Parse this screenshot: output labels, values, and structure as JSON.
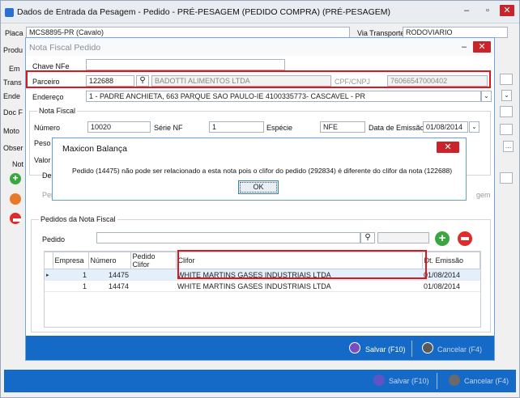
{
  "main_window": {
    "title": "Dados de Entrada da Pesagem - Pedido - PRÉ-PESAGEM (PEDIDO COMPRA) (PRÉ-PESAGEM)",
    "placa_label": "Placa",
    "placa_value": "MCS8895-PR (Cavalo)",
    "via_transporte_label": "Via Transporte",
    "via_transporte_value": "RODOVIARIO",
    "left_labels": [
      "Produ",
      "Em",
      "Trans",
      "Ende",
      "Doc F",
      "Moto",
      "Obser",
      "Not"
    ],
    "salvar_label": "Salvar (F10)",
    "cancelar_label": "Cancelar (F4)"
  },
  "nf_dialog": {
    "title": "Nota Fiscal Pedido",
    "chave_nfe_label": "Chave NFe",
    "chave_nfe_value": "",
    "parceiro_label": "Parceiro",
    "parceiro_code": "122688",
    "parceiro_name": "BADOTTI ALIMENTOS LTDA",
    "cpf_cnpj_label": "CPF/CNPJ",
    "cpf_cnpj_value": "76066547000402",
    "endereco_label": "Endereço",
    "endereco_value": "1 - PADRE ANCHIETA, 663  PARQUE SAO PAULO-IE 4100335773- CASCAVEL - PR",
    "nota_fiscal_group": "Nota Fiscal",
    "numero_label": "Número",
    "numero_value": "10020",
    "serie_label": "Série NF",
    "serie_value": "1",
    "especie_label": "Espécie",
    "especie_value": "NFE",
    "data_emissao_label": "Data de Emissão",
    "data_emissao_value": "01/08/2014",
    "peso_label": "Peso Or",
    "valor_label": "Valor Ur",
    "desdo_label": "Desdo",
    "perce_label": "Perce",
    "gem_label": "gem",
    "pedidos_group": "Pedidos da Nota Fiscal",
    "pedido_label": "Pedido",
    "pedido_value": "",
    "grid": {
      "headers": [
        "Empresa",
        "Número",
        "Pedido Clifor",
        "Clifor",
        "Dt. Emissão"
      ],
      "rows": [
        {
          "empresa": "1",
          "numero": "14475",
          "pedido_clifor": "",
          "clifor": "WHITE MARTINS GASES INDUSTRIAIS LTDA",
          "dt_emissao": "01/08/2014"
        },
        {
          "empresa": "1",
          "numero": "14474",
          "pedido_clifor": "",
          "clifor": "WHITE MARTINS GASES INDUSTRIAIS LTDA",
          "dt_emissao": "01/08/2014"
        }
      ]
    },
    "salvar_label": "Salvar (F10)",
    "cancelar_label": "Cancelar (F4)"
  },
  "message_box": {
    "title": "Maxicon Balança",
    "message": "Pedido (14475) não pode ser relacionado a esta nota pois o clifor do pedido (292834) é diferente do clifor da nota (122688)",
    "ok_label": "OK"
  },
  "colors": {
    "accent_blue": "#1569c7",
    "highlight_red": "#e0161d",
    "close_red": "#c8242a",
    "add_green": "#3aa63f"
  }
}
